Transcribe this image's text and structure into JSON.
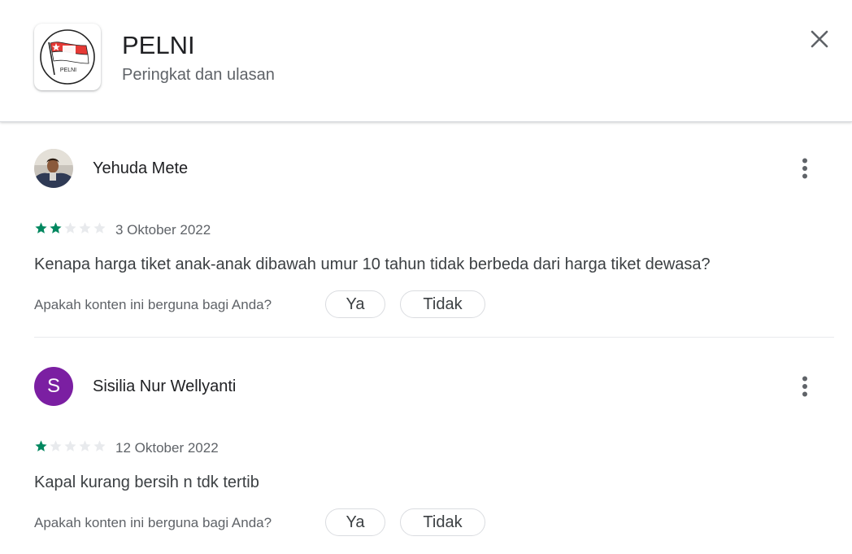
{
  "header": {
    "app_title": "PELNI",
    "subtitle": "Peringkat dan ulasan",
    "logo_text": "PELNI"
  },
  "reviews": [
    {
      "name": "Yehuda Mete",
      "avatar": "photo",
      "rating": 2,
      "max_rating": 5,
      "date": "3 Oktober 2022",
      "text": "Kenapa harga tiket anak-anak dibawah umur 10 tahun tidak berbeda dari harga tiket dewasa?",
      "helpful_question": "Apakah konten ini berguna bagi Anda?",
      "yes_label": "Ya",
      "no_label": "Tidak"
    },
    {
      "name": "Sisilia Nur Wellyanti",
      "avatar_letter": "S",
      "rating": 1,
      "max_rating": 5,
      "date": "12 Oktober 2022",
      "text": "Kapal kurang bersih n tdk tertib",
      "helpful_question": "Apakah konten ini berguna bagi Anda?",
      "yes_label": "Ya",
      "no_label": "Tidak"
    }
  ],
  "colors": {
    "star_filled": "#01875f",
    "star_empty": "#e8eaed",
    "avatar_s": "#7b1fa2",
    "logo_red": "#e53935"
  },
  "icons": {
    "close": "close-icon",
    "more": "more-vert-icon",
    "star": "star-icon"
  }
}
